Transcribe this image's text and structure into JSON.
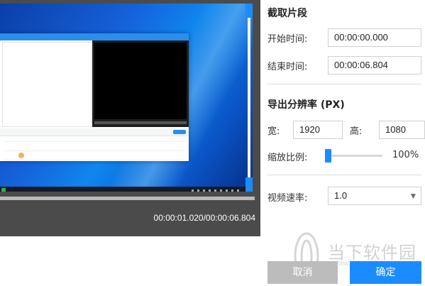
{
  "preview": {
    "timecode": "00:00:01.020/00:00:06.804",
    "progress_fraction": 0.15
  },
  "clip": {
    "title": "截取片段",
    "start_label": "开始时间:",
    "start_value": "00:00:00.000",
    "end_label": "结束时间:",
    "end_value": "00:00:06.804"
  },
  "resolution": {
    "title": "导出分辨率 (PX)",
    "width_label": "宽:",
    "width_value": "1920",
    "height_label": "高:",
    "height_value": "1080",
    "scale_label": "缩放比例:",
    "scale_value": "100%"
  },
  "speed": {
    "label": "视频速率:",
    "selected": "1.0"
  },
  "buttons": {
    "cancel": "取消",
    "ok": "确定"
  },
  "watermark": {
    "text": "当下软件园",
    "url": "www.downxia.com"
  },
  "colors": {
    "accent": "#1a8cff",
    "cancel_bg": "#bcbcbc",
    "preview_bg": "#4b4b4b"
  }
}
